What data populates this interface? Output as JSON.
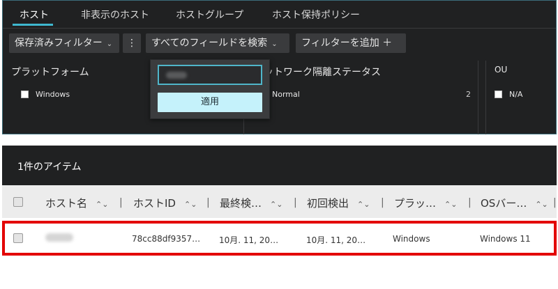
{
  "tabs": [
    {
      "label": "ホスト",
      "active": true
    },
    {
      "label": "非表示のホスト",
      "active": false
    },
    {
      "label": "ホストグループ",
      "active": false
    },
    {
      "label": "ホスト保持ポリシー",
      "active": false
    }
  ],
  "toolbar": {
    "saved_filters": "保存済みフィルター",
    "more": "⋮",
    "search_all_fields": "すべてのフィールドを検索",
    "add_filter": "フィルターを追加 ＋"
  },
  "facets": {
    "platform": {
      "title": "プラットフォーム",
      "option": "Windows"
    },
    "network": {
      "title": "ットワーク隔離ステータス",
      "option": "Normal",
      "count": "2"
    },
    "ou": {
      "title": "OU",
      "option": "N/A"
    }
  },
  "popup": {
    "apply_label": "適用"
  },
  "results": {
    "title": "1件のアイテム",
    "columns": [
      "ホスト名",
      "ホストID",
      "最終検…",
      "初回検出",
      "プラッ…",
      "OSバー…"
    ],
    "rows": [
      {
        "host_id": "78cc88df9357…",
        "last_seen": "10月. 11, 20…",
        "first_seen": "10月. 11, 20…",
        "platform": "Windows",
        "os_version": "Windows 11"
      }
    ]
  },
  "accent_color": "#3fb8cf",
  "highlight_color": "#e30000"
}
